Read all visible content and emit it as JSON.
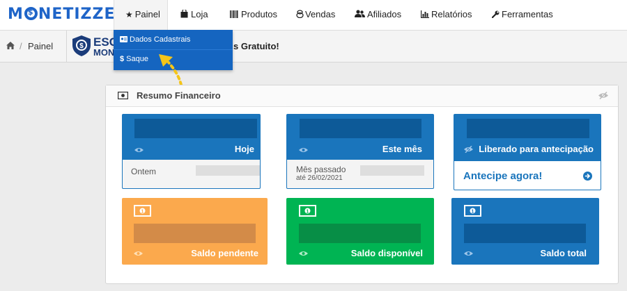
{
  "brand": {
    "logo_pre": "M",
    "logo_post": "NETIZZE"
  },
  "nav": {
    "items": [
      {
        "label": "Painel",
        "icon": "star-icon"
      },
      {
        "label": "Loja",
        "icon": "shopping-bag-icon"
      },
      {
        "label": "Produtos",
        "icon": "barcode-icon"
      },
      {
        "label": "Vendas",
        "icon": "money-icon"
      },
      {
        "label": "Afiliados",
        "icon": "users-icon"
      },
      {
        "label": "Relatórios",
        "icon": "bar-chart-icon"
      },
      {
        "label": "Ferramentas",
        "icon": "wrench-icon"
      }
    ]
  },
  "dropdown": {
    "items": [
      {
        "label": "Dados Cadastrais",
        "icon": "id-card-icon"
      },
      {
        "label": "Saque",
        "icon": "dollar-icon"
      }
    ]
  },
  "breadcrumb": {
    "label": "Painel",
    "separator": "/"
  },
  "promo": {
    "line1": "ESC",
    "line2": "MON",
    "text": "s Gratuito!"
  },
  "panel": {
    "title": "Resumo Financeiro",
    "cards": {
      "hoje": {
        "label": "Hoje",
        "bottom_label": "Ontem"
      },
      "este_mes": {
        "label": "Este mês",
        "bottom_label": "Mês passado",
        "bottom_sub": "até 26/02/2021"
      },
      "liberado": {
        "label": "Liberado para antecipação",
        "cta": "Antecipe agora!"
      },
      "pendente": {
        "label": "Saldo pendente"
      },
      "disponivel": {
        "label": "Saldo disponível"
      },
      "total": {
        "label": "Saldo total"
      }
    }
  },
  "colors": {
    "brand_blue": "#1e64c8",
    "card_blue": "#1a75bc",
    "pending_orange": "#fba94d",
    "available_green": "#00b453",
    "highlight_arrow": "#f5c518"
  }
}
